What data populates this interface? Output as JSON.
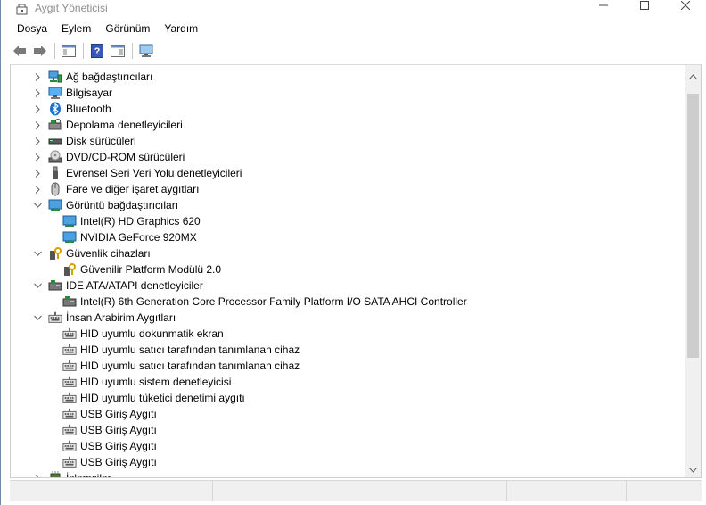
{
  "window": {
    "title": "Aygıt Yöneticisi"
  },
  "menu": [
    "Dosya",
    "Eylem",
    "Görünüm",
    "Yardım"
  ],
  "tree": [
    {
      "label": "Ağ bağdaştırıcıları",
      "icon": "network-adapter-icon",
      "expanded": false,
      "children": []
    },
    {
      "label": "Bilgisayar",
      "icon": "computer-icon",
      "expanded": false,
      "children": []
    },
    {
      "label": "Bluetooth",
      "icon": "bluetooth-icon",
      "expanded": false,
      "children": []
    },
    {
      "label": "Depolama denetleyicileri",
      "icon": "storage-controller-icon",
      "expanded": false,
      "children": []
    },
    {
      "label": "Disk sürücüleri",
      "icon": "disk-drive-icon",
      "expanded": false,
      "children": []
    },
    {
      "label": "DVD/CD-ROM sürücüleri",
      "icon": "dvd-drive-icon",
      "expanded": false,
      "children": []
    },
    {
      "label": "Evrensel Seri Veri Yolu denetleyicileri",
      "icon": "usb-icon",
      "expanded": false,
      "children": []
    },
    {
      "label": "Fare ve diğer işaret aygıtları",
      "icon": "mouse-icon",
      "expanded": false,
      "children": []
    },
    {
      "label": "Görüntü bağdaştırıcıları",
      "icon": "display-adapter-icon",
      "expanded": true,
      "children": [
        {
          "label": "Intel(R) HD Graphics 620",
          "icon": "display-adapter-icon"
        },
        {
          "label": "NVIDIA GeForce 920MX",
          "icon": "display-adapter-icon"
        }
      ]
    },
    {
      "label": "Güvenlik cihazları",
      "icon": "security-device-icon",
      "expanded": true,
      "children": [
        {
          "label": "Güvenilir Platform Modülü 2.0",
          "icon": "security-device-icon"
        }
      ]
    },
    {
      "label": "IDE ATA/ATAPI denetleyiciler",
      "icon": "ide-controller-icon",
      "expanded": true,
      "children": [
        {
          "label": "Intel(R) 6th Generation Core Processor Family Platform I/O SATA AHCI Controller",
          "icon": "ide-controller-icon"
        }
      ]
    },
    {
      "label": "İnsan Arabirim Aygıtları",
      "icon": "hid-icon",
      "expanded": true,
      "children": [
        {
          "label": "HID uyumlu dokunmatik ekran",
          "icon": "hid-icon"
        },
        {
          "label": "HID uyumlu satıcı tarafından tanımlanan cihaz",
          "icon": "hid-icon"
        },
        {
          "label": "HID uyumlu satıcı tarafından tanımlanan cihaz",
          "icon": "hid-icon"
        },
        {
          "label": "HID uyumlu sistem denetleyicisi",
          "icon": "hid-icon"
        },
        {
          "label": "HID uyumlu tüketici denetimi aygıtı",
          "icon": "hid-icon"
        },
        {
          "label": "USB Giriş Aygıtı",
          "icon": "hid-icon"
        },
        {
          "label": "USB Giriş Aygıtı",
          "icon": "hid-icon"
        },
        {
          "label": "USB Giriş Aygıtı",
          "icon": "hid-icon"
        },
        {
          "label": "USB Giriş Aygıtı",
          "icon": "hid-icon"
        }
      ]
    },
    {
      "label": "İşlemciler",
      "icon": "processor-icon",
      "expanded": false,
      "children": []
    }
  ]
}
